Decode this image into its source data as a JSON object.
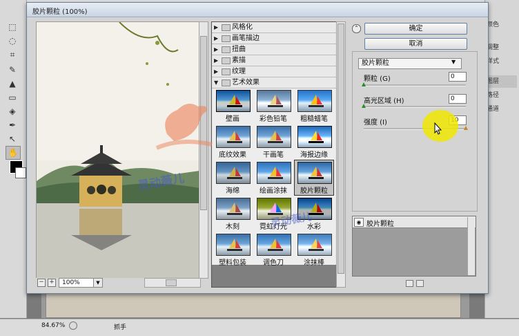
{
  "workspace": {
    "toolbar_icons": [
      "marquee-icon",
      "lasso-icon",
      "crop-icon",
      "brush-icon",
      "stamp-icon",
      "eraser-icon",
      "blur-icon",
      "pen-icon",
      "path-select-icon",
      "hand-icon",
      "zoom-icon"
    ],
    "right_panel": [
      "颜色",
      "调整",
      "样式",
      "图层",
      "路径",
      "通道"
    ],
    "status": {
      "zoom": "84.67%",
      "tool_name": "抓手"
    }
  },
  "dialog": {
    "title": "胶片颗粒 (100%)",
    "preview_zoom": "100%",
    "categories": [
      "风格化",
      "画笔描边",
      "扭曲",
      "素描",
      "纹理",
      "艺术效果"
    ],
    "expanded_category": "艺术效果",
    "thumbnails": [
      "壁画",
      "彩色铅笔",
      "粗糙蜡笔",
      "底纹效果",
      "干画笔",
      "海报边缘",
      "海绵",
      "绘画涂抹",
      "胶片颗粒",
      "木刻",
      "霓虹灯光",
      "水彩",
      "塑料包装",
      "调色刀",
      "涂抹棒"
    ],
    "selected_thumbnail": "胶片颗粒",
    "ok_label": "确定",
    "cancel_label": "取消",
    "filter_select": "胶片颗粒",
    "params": [
      {
        "label": "颗粒 (G)",
        "value": "0",
        "fill": 0.0
      },
      {
        "label": "高光区域 (H)",
        "value": "0",
        "fill": 0.0
      },
      {
        "label": "强度 (I)",
        "value": "10",
        "fill": 1.0
      }
    ],
    "layer_name": "胶片颗粒"
  },
  "watermark": {
    "text": "灵动薇儿"
  },
  "colors": {
    "highlight": "#f0e600",
    "title_bar": "#c9d4e3",
    "selected_thumb": "#c4c4c4"
  }
}
